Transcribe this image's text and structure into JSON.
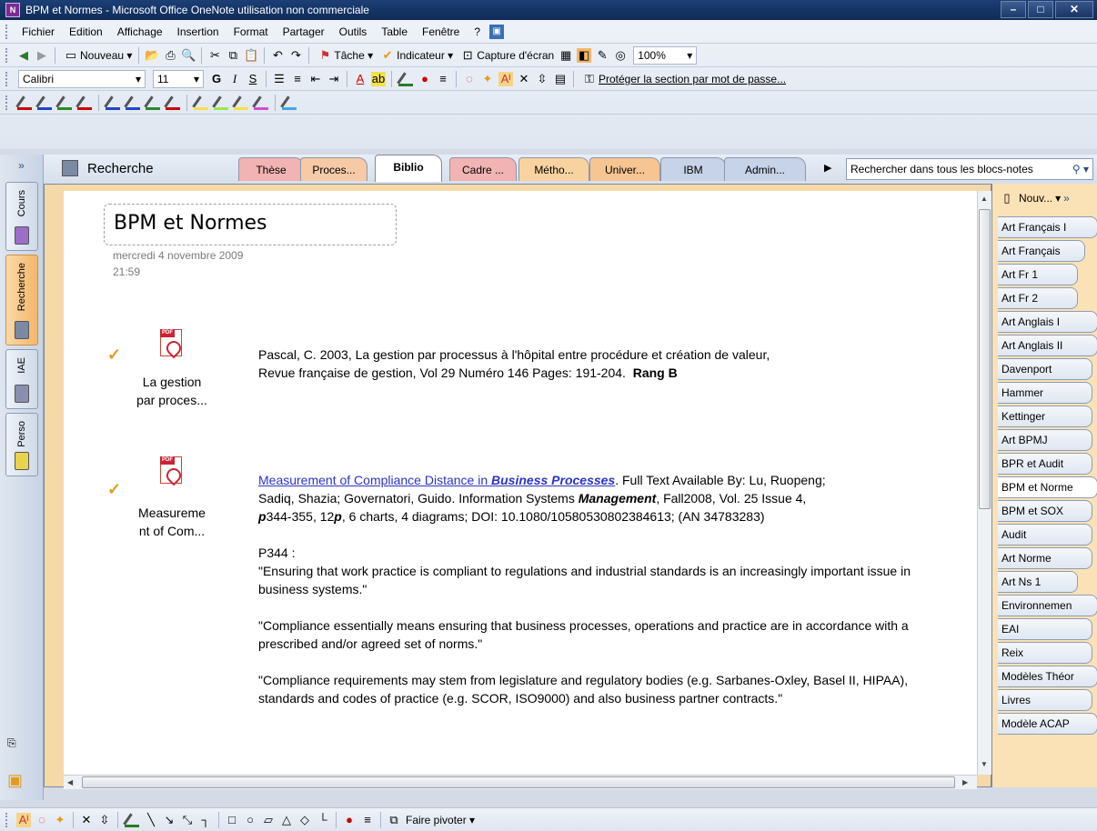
{
  "window": {
    "title": "BPM et Normes - Microsoft Office OneNote utilisation non commerciale",
    "app_icon": "onenote-icon"
  },
  "menu": [
    "Fichier",
    "Edition",
    "Affichage",
    "Insertion",
    "Format",
    "Partager",
    "Outils",
    "Table",
    "Fenêtre",
    "?"
  ],
  "toolbar1": {
    "new_label": "Nouveau",
    "task_label": "Tâche",
    "indicator_label": "Indicateur",
    "capture_label": "Capture d'écran",
    "zoom": "100%"
  },
  "toolbar2": {
    "font": "Calibri",
    "size": "11",
    "bold": "G",
    "italic": "I",
    "underline": "S",
    "protect_label": "Protéger la section par mot de passe..."
  },
  "notebooks": [
    {
      "label": "Cours",
      "color": "#9b6fc7"
    },
    {
      "label": "Recherche",
      "color": "#7a8aa4",
      "active": true
    },
    {
      "label": "IAE",
      "color": "#8a8fb0"
    },
    {
      "label": "Perso",
      "color": "#e8d44a"
    }
  ],
  "notebook_title": "Recherche",
  "sections": [
    {
      "label": "Thèse",
      "color": "#f2b3b3"
    },
    {
      "label": "Proces...",
      "color": "#f6c9a7"
    },
    {
      "label": "Biblio",
      "color": "#ffffff",
      "active": true
    },
    {
      "label": "Cadre ...",
      "color": "#f2b3b3"
    },
    {
      "label": "Métho...",
      "color": "#f8d3a0"
    },
    {
      "label": "Univer...",
      "color": "#f6c592"
    },
    {
      "label": "IBM",
      "color": "#c7d3e8"
    },
    {
      "label": "Admin...",
      "color": "#c7d3e8"
    }
  ],
  "search": {
    "placeholder": "Rechercher dans tous les blocs-notes"
  },
  "page": {
    "title": "BPM et Normes",
    "date": "mercredi 4 novembre 2009",
    "time": "21:59",
    "attachments": [
      {
        "label_line1": "La gestion",
        "label_line2": "par proces..."
      },
      {
        "label_line1": "Measureme",
        "label_line2": "nt of Com..."
      }
    ],
    "ref1_line1": "Pascal, C. 2003, La gestion par processus à l'hôpital entre procédure et création de valeur,",
    "ref1_line2": "Revue française de gestion, Vol 29 Numéro 146 Pages: 191-204.",
    "ref1_rank": "Rang B",
    "ref2_link": "Measurement of Compliance Distance in ",
    "ref2_link_bold": "Business Processes",
    "ref2_rest1": ". Full Text Available By: Lu, Ruopeng;",
    "ref2_line2a": "Sadiq, Shazia; Governatori, Guido. Information Systems ",
    "ref2_line2b": "Management",
    "ref2_line2c": ", Fall2008, Vol. 25 Issue 4,",
    "ref2_line3a": "p",
    "ref2_line3b": "344-355, 12",
    "ref2_line3c": "p",
    "ref2_line3d": ", 6 charts, 4 diagrams; DOI: 10.1080/10580530802384613;  (AN 34783283)",
    "p344": "P344 :",
    "quote1": "\"Ensuring that work practice is compliant to regulations and industrial standards is an increasingly important issue in business systems.\"",
    "quote2": "\"Compliance essentially means ensuring that business processes, operations and practice are in accordance with a prescribed and/or agreed set of norms.\"",
    "quote3": "\"Compliance requirements may stem from legislature and regulatory bodies (e.g. Sarbanes-Oxley, Basel II, HIPAA), standards and codes of practice (e.g. SCOR, ISO9000) and also business partner contracts.\""
  },
  "pages_pane": {
    "new_label": "Nouv...",
    "pages": [
      "Art Français I",
      "Art Français",
      "Art Fr 1",
      "Art Fr 2",
      "Art Anglais I",
      "Art Anglais II",
      "Davenport",
      "Hammer",
      "Kettinger",
      "Art BPMJ",
      "BPR et Audit",
      "BPM et Norme",
      "BPM et SOX",
      "Audit",
      "Art Norme",
      "Art Ns 1",
      "Environnemen",
      "EAI",
      "Reix",
      "Modèles Théor",
      "Livres",
      "Modèle ACAP"
    ],
    "active_index": 11
  },
  "bottom_toolbar": {
    "rotate_label": "Faire pivoter"
  },
  "colors": {
    "accent_orange": "#f3b66a",
    "link_blue": "#2b34c7",
    "check_orange": "#e39a1c"
  }
}
